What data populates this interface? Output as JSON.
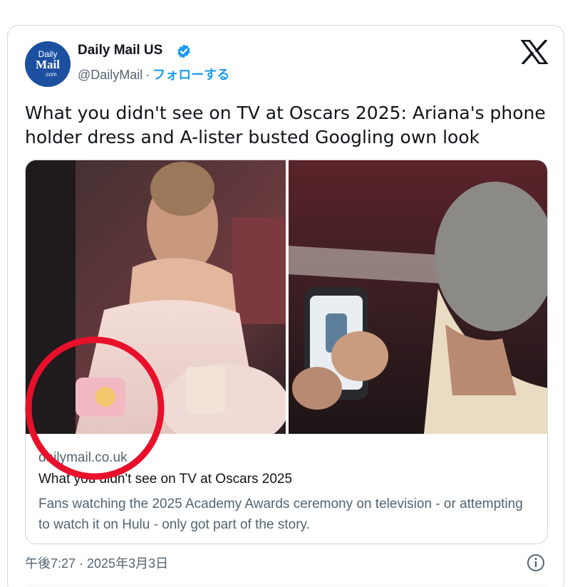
{
  "author": {
    "name": "Daily Mail US",
    "handle": "@DailyMail",
    "separator": "·",
    "follow_label": "フォローする",
    "avatar_text": [
      "Daily",
      "Mail",
      ".com"
    ],
    "verified_color": "#1d9bf0"
  },
  "brand_icon": "x-logo-icon",
  "tweet": {
    "text": "What you didn't see on TV at Oscars 2025: Ariana's phone holder dress and A-lister busted Googling own look"
  },
  "link_card": {
    "domain": "dailymail.co.uk",
    "title": "What you didn't see on TV at Oscars 2025",
    "description": "Fans watching the 2025 Academy Awards ceremony on television - or attempting to watch it on Hulu - only got part of the story.",
    "images": [
      "woman-in-pink-dress-holding-phone-case-photo",
      "man-looking-at-smartphone-photo"
    ]
  },
  "annotation": {
    "color": "#e8102a",
    "shape": "circle"
  },
  "footer": {
    "timestamp": "午後7:27 · 2025年3月3日",
    "info_icon": "info-icon"
  },
  "colors": {
    "accent": "#1d9bf0",
    "text_primary": "#0f1419",
    "text_secondary": "#536471",
    "border": "#cfd9de"
  }
}
